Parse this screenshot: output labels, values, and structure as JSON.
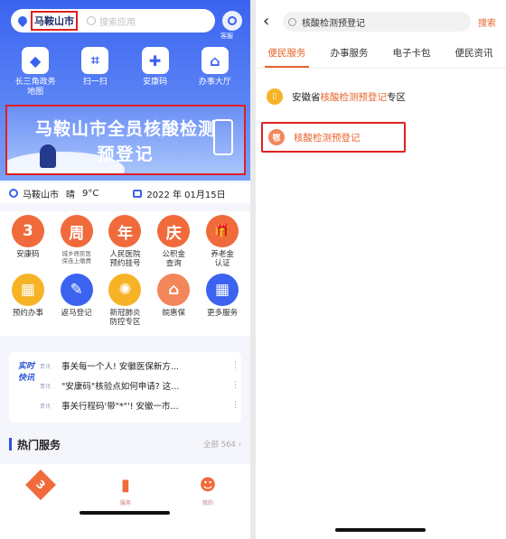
{
  "left": {
    "search": {
      "city": "马鞍山市",
      "placeholder": "搜索应用"
    },
    "scan_label": "客服",
    "quick": [
      {
        "label": "长三角政务\n地图",
        "icon": "map-icon",
        "glyph": "◆"
      },
      {
        "label": "扫一扫",
        "icon": "scan-icon",
        "glyph": "⌗"
      },
      {
        "label": "安康码",
        "icon": "health-code-icon",
        "glyph": "✚"
      },
      {
        "label": "办事大厅",
        "icon": "hall-icon",
        "glyph": "⌂"
      }
    ],
    "banner": {
      "line1": "马鞍山市全员核酸检测",
      "line2": "预登记"
    },
    "info": {
      "city": "马鞍山市",
      "weather": "晴",
      "temp": "9°C",
      "date": "2022 年 01月15日"
    },
    "grid": [
      [
        {
          "label": "安康码",
          "glyph": "3",
          "color": "#f06a3b",
          "small": false
        },
        {
          "label": "城乡居民医\n保连上缴费",
          "glyph": "周",
          "color": "#f06a3b",
          "small": true
        },
        {
          "label": "人民医院\n预约挂号",
          "glyph": "年",
          "color": "#f06a3b",
          "small": false
        },
        {
          "label": "公积金\n查询",
          "glyph": "庆",
          "color": "#f06a3b",
          "small": false
        },
        {
          "label": "养老金\n认证",
          "glyph": "🎁",
          "color": "#f06a3b",
          "small": false
        }
      ],
      [
        {
          "label": "预约办事",
          "glyph": "▦",
          "color": "#f6b326",
          "small": false
        },
        {
          "label": "返马登记",
          "glyph": "✎",
          "color": "#3b63f0",
          "small": false
        },
        {
          "label": "新冠肺炎\n防控专区",
          "glyph": "✺",
          "color": "#f6b326",
          "small": false
        },
        {
          "label": "皖惠保",
          "glyph": "⌂",
          "color": "#f3865a",
          "small": false
        },
        {
          "label": "更多服务",
          "glyph": "▦",
          "color": "#3b63f0",
          "small": false
        }
      ]
    ],
    "news": {
      "tag": "实时快讯",
      "items": [
        {
          "src": "青讯",
          "text": "事关每一个人! 安徽医保新方..."
        },
        {
          "src": "青讯",
          "text": "\"安康码\"核验点如何申请? 这..."
        },
        {
          "src": "青讯",
          "text": "事关行程码'带\"*\"'! 安徽一市..."
        }
      ],
      "more": "⋮"
    },
    "hot": {
      "title": "热门服务",
      "all": "全部 564 ›"
    },
    "tabbar": [
      {
        "label": "",
        "glyph": "3"
      },
      {
        "label": "服务",
        "glyph": "▮"
      },
      {
        "label": "我的",
        "glyph": "☻"
      }
    ]
  },
  "right": {
    "search_text": "核酸检测预登记",
    "search_button": "搜索",
    "tabs": [
      "便民服务",
      "办事服务",
      "电子卡包",
      "便民资讯"
    ],
    "results": [
      {
        "prefix": "安徽省",
        "highlight": "核酸检测预登记",
        "suffix": "专区",
        "glyph": "▯",
        "color": "#f6b326"
      },
      {
        "prefix": "",
        "highlight": "核酸检测预登记",
        "suffix": "",
        "glyph": "鄂",
        "color": "#f3865a"
      }
    ]
  },
  "colors": {
    "primary": "#3b63f0",
    "accent": "#e8642b",
    "highlight_box": "#e02020"
  }
}
